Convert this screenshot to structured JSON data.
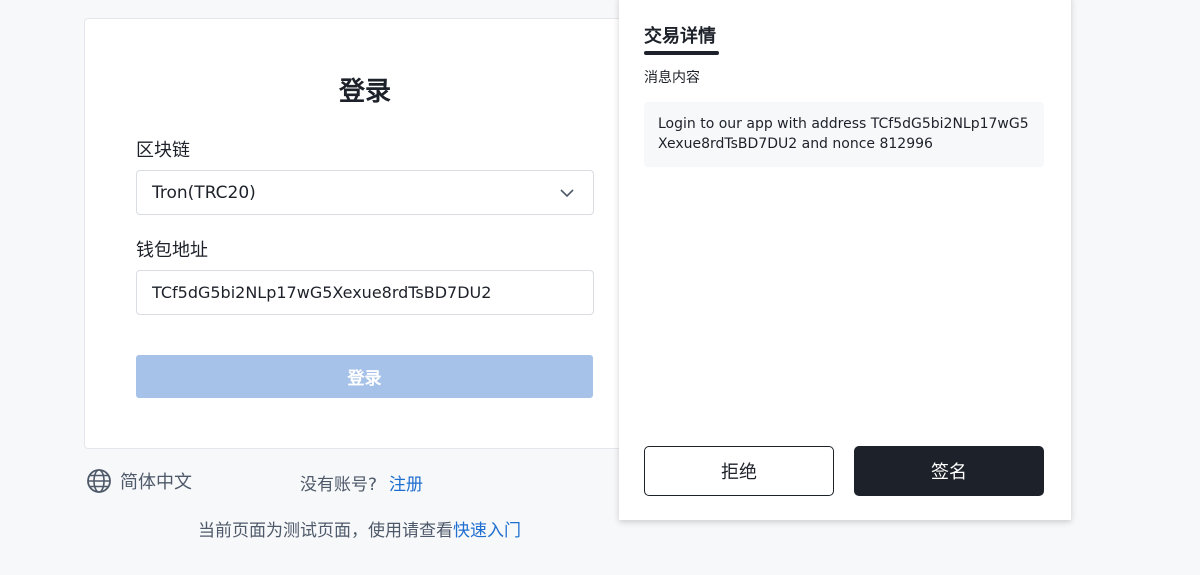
{
  "login": {
    "title": "登录",
    "blockchain_label": "区块链",
    "blockchain_value": "Tron(TRC20)",
    "wallet_label": "钱包地址",
    "wallet_value": "TCf5dG5bi2NLp17wG5Xexue8rdTsBD7DU2",
    "submit_label": "登录"
  },
  "footer": {
    "language": "简体中文",
    "no_account": "没有账号?",
    "register": "注册",
    "test_notice": "当前页面为测试页面，使用请查看",
    "quick_start": "快速入门"
  },
  "transaction": {
    "tab_title": "交易详情",
    "message_label": "消息内容",
    "message": "Login to our app with address TCf5dG5bi2NLp17wG5Xexue8rdTsBD7DU2 and nonce 812996",
    "reject_label": "拒绝",
    "sign_label": "签名"
  },
  "icons": {
    "language": "globe-icon",
    "select": "chevron-down-icon"
  },
  "colors": {
    "accent_link": "#1f6fd0",
    "disabled_button": "#a6c2e8",
    "dark_button": "#1d2129"
  }
}
